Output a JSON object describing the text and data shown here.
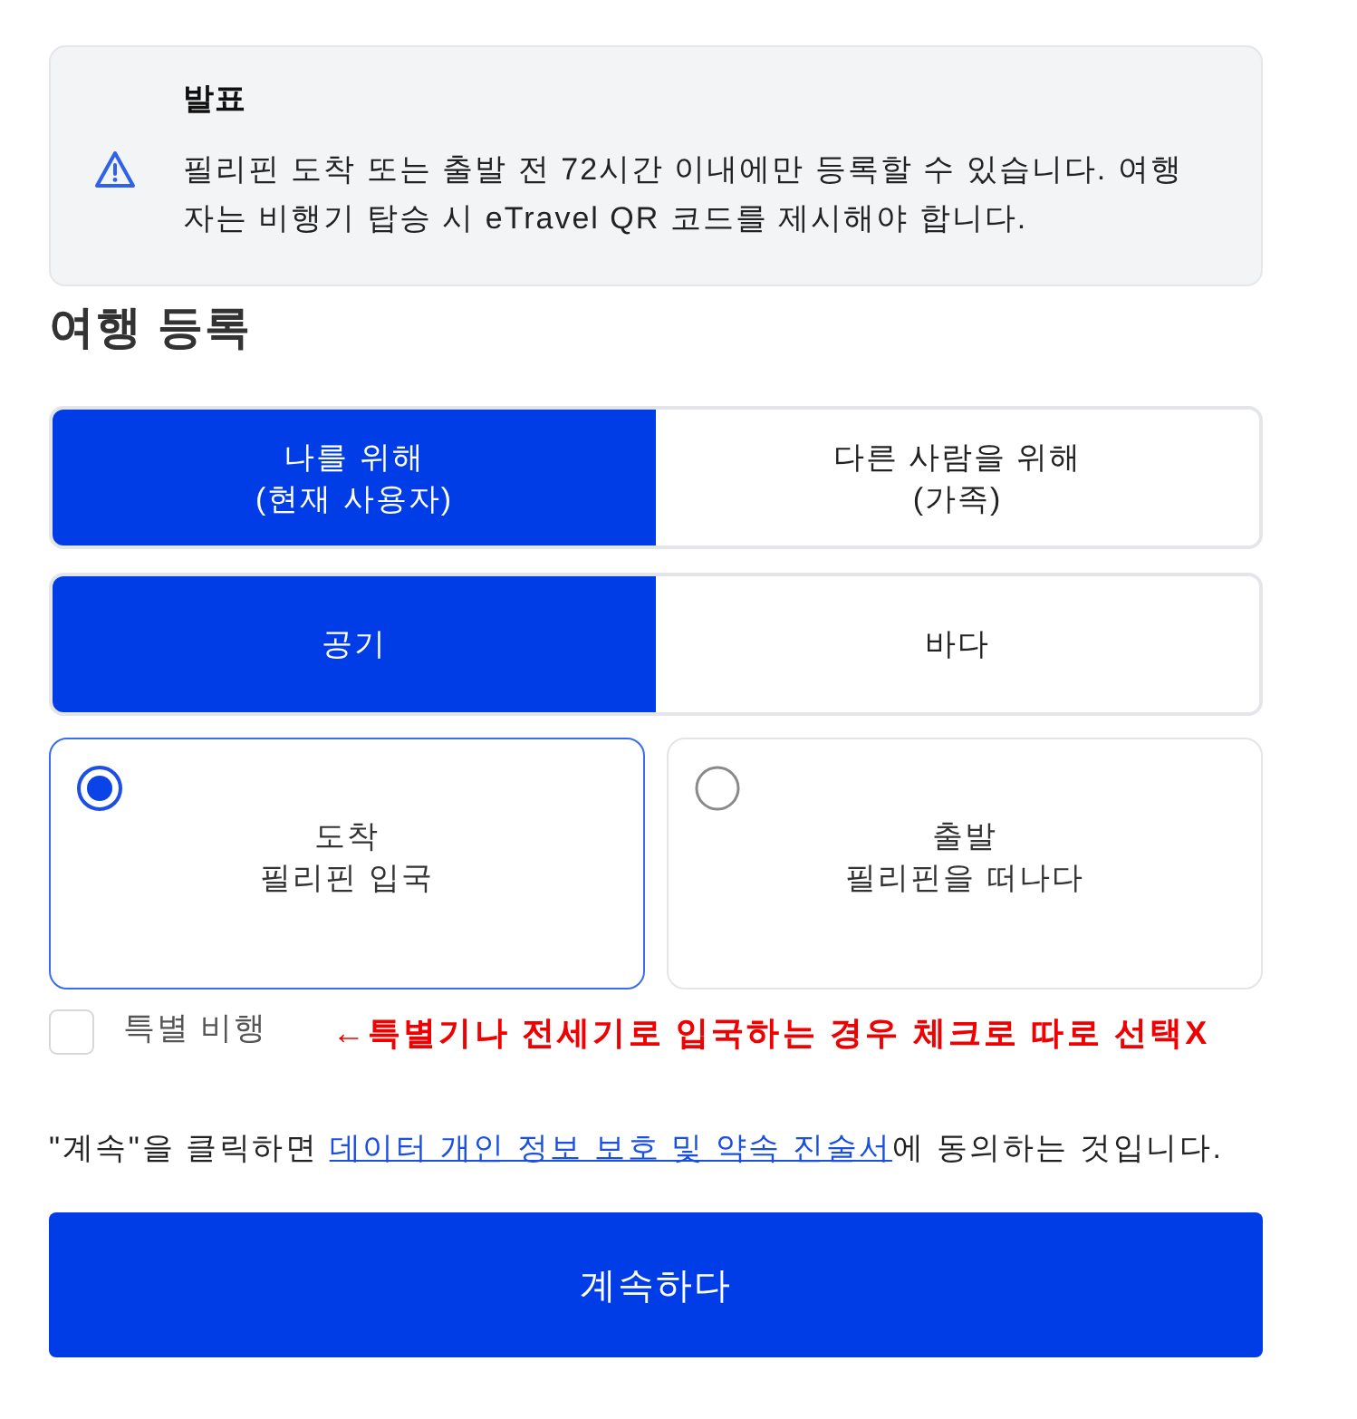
{
  "announcement": {
    "title": "발표",
    "message": "필리핀 도착 또는 출발 전 72시간 이내에만 등록할 수 있습니다. 여행자는 비행기 탑승 시 eTravel QR 코드를 제시해야 합니다."
  },
  "heading": "여행 등록",
  "traveler_toggle": [
    {
      "label": "나를 위해",
      "sublabel": "(현재 사용자)",
      "selected": true
    },
    {
      "label": "다른 사람을 위해",
      "sublabel": "(가족)",
      "selected": false
    }
  ],
  "mode_toggle": [
    {
      "label": "공기",
      "selected": true
    },
    {
      "label": "바다",
      "selected": false
    }
  ],
  "direction_options": [
    {
      "label": "도착",
      "sublabel": "필리핀 입국",
      "selected": true
    },
    {
      "label": "출발",
      "sublabel": "필리핀을 떠나다",
      "selected": false
    }
  ],
  "special_flight": {
    "label": "특별 비행",
    "checked": false
  },
  "annotation": "←특별기나 전세기로 입국하는 경우 체크로 따로 선택X",
  "consent": {
    "before": "\"계속\"을 클릭하면 ",
    "link": "데이터 개인 정보 보호 및 약속 진술서",
    "after": "에 동의하는 것입니다."
  },
  "continue_button": "계속하다"
}
